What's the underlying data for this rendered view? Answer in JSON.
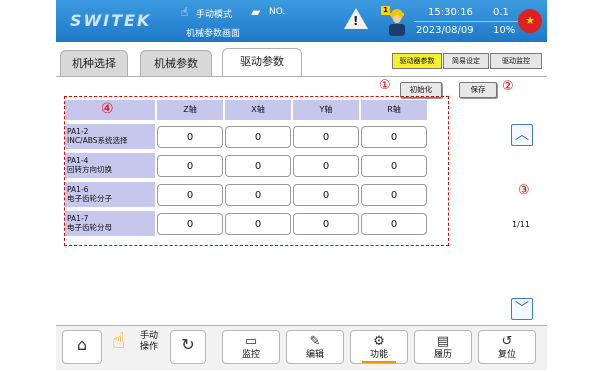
{
  "header": {
    "logo": "SWITEK",
    "mode_icon": "hand-pointer-icon",
    "mode": "手动模式",
    "folder_icon": "folder-icon",
    "program_no": "NO.",
    "subtitle": "机械参数画面",
    "warning_icon": "warning-icon",
    "operator_icon": "operator-icon",
    "operator_level": "1",
    "time": "15:30:16",
    "date": "2023/08/09",
    "value_top": "0.1",
    "value_bottom": "10%",
    "flag_icon": "china-flag-icon"
  },
  "tabs": [
    {
      "label": "机种选择"
    },
    {
      "label": "机械参数"
    },
    {
      "label": "驱动参数",
      "active": true
    }
  ],
  "sub_tabs": [
    {
      "label": "驱动器参数",
      "active": true,
      "color": "#f6ef2b"
    },
    {
      "label": "简易设定"
    },
    {
      "label": "驱动监控"
    }
  ],
  "actions": {
    "init_label": "初始化",
    "save_label": "保存",
    "marker_1": "①",
    "marker_2": "②",
    "marker_3": "③",
    "marker_4": "④"
  },
  "table": {
    "columns": [
      "Z轴",
      "X轴",
      "Y轴",
      "R轴"
    ],
    "rows": [
      {
        "code": "PA1-2",
        "name": "INC/ABS系统选择",
        "values": [
          "0",
          "0",
          "0",
          "0"
        ]
      },
      {
        "code": "PA1-4",
        "name": "回转方向切换",
        "values": [
          "0",
          "0",
          "0",
          "0"
        ]
      },
      {
        "code": "PA1-6",
        "name": "电子齿轮分子",
        "values": [
          "0",
          "0",
          "0",
          "0"
        ]
      },
      {
        "code": "PA1-7",
        "name": "电子齿轮分母",
        "values": [
          "0",
          "0",
          "0",
          "0"
        ]
      }
    ]
  },
  "pager": {
    "up_icon": "chevron-up-icon",
    "down_icon": "chevron-down-icon",
    "page": "1/11"
  },
  "bottom_nav": {
    "home_icon": "home-icon",
    "manual_label_1": "手动",
    "manual_label_2": "操作",
    "hand_icon": "hand-icon",
    "cycle_icon": "cycle-icon",
    "items": [
      {
        "label": "监控",
        "icon": "monitor-icon"
      },
      {
        "label": "编辑",
        "icon": "edit-icon"
      },
      {
        "label": "功能",
        "icon": "gear-icon",
        "active": true
      },
      {
        "label": "履历",
        "icon": "history-icon"
      },
      {
        "label": "复位",
        "icon": "reset-icon"
      }
    ]
  },
  "colors": {
    "header": "#1e78c8",
    "row_header": "#c7c7ee",
    "active_subtab": "#f6ef2b",
    "accent": "#f29200",
    "annotation": "#dd0000"
  }
}
